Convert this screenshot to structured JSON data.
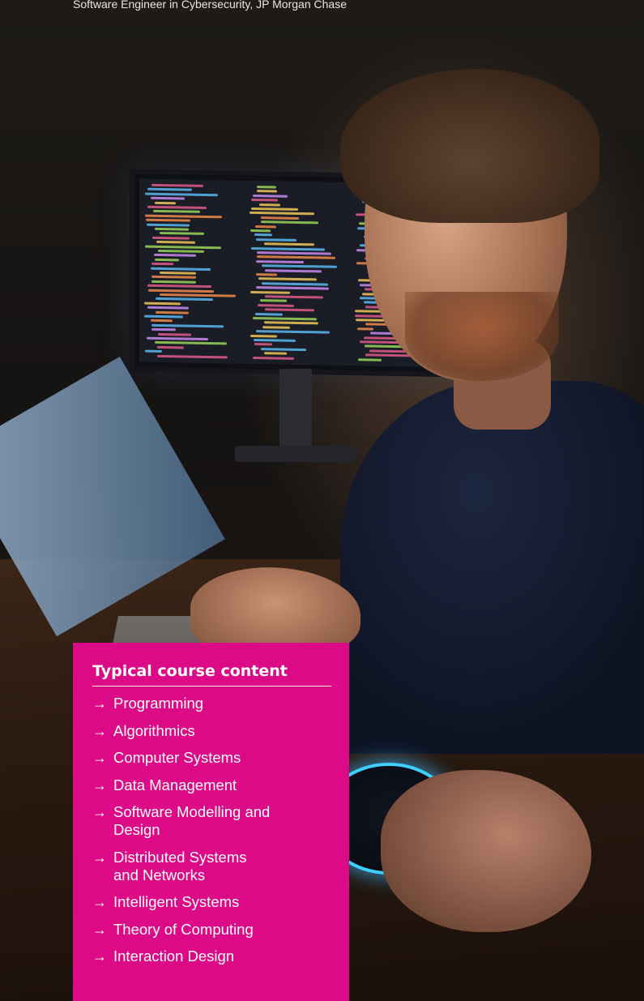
{
  "caption": "Software Engineer in Cybersecurity, JP Morgan Chase",
  "course": {
    "title": "Typical course content",
    "bullet_icon": "arrow-right-icon",
    "items": [
      {
        "label": "Programming"
      },
      {
        "label": "Algorithmics"
      },
      {
        "label": "Computer Systems"
      },
      {
        "label": "Data Management"
      },
      {
        "label": "Software Modelling and Design"
      },
      {
        "label": "Distributed Systems and Networks"
      },
      {
        "label": "Intelligent Systems"
      },
      {
        "label": "Theory of Computing"
      },
      {
        "label": "Interaction Design"
      }
    ]
  },
  "colors": {
    "accent_box": "#dc0a87",
    "text_on_accent": "#ffffff",
    "speaker_glow": "#3ed0ff"
  }
}
